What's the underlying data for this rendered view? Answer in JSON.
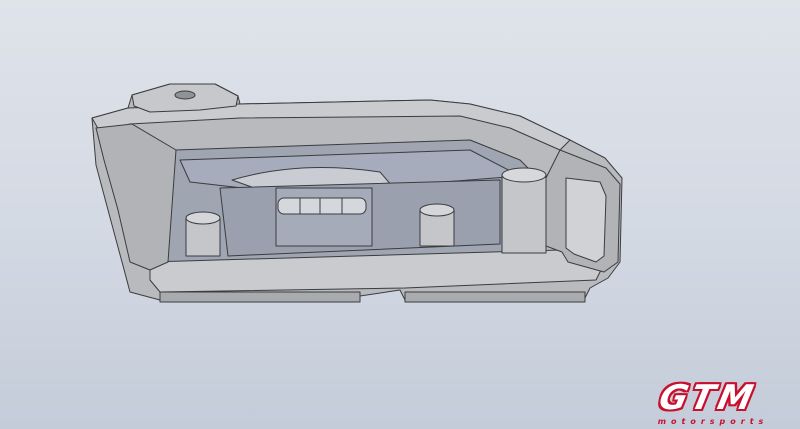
{
  "viewport": {
    "background_top": "#dfe3ea",
    "background_bottom": "#c4ccd9"
  },
  "model": {
    "part_color": "#b8babd",
    "part_shade": "#8f9296",
    "section_color": "#c9cbce",
    "inner_color": "#a9aeb8",
    "edge_color": "#3a3c3f"
  },
  "logo": {
    "brand": "GTM",
    "tagline": "motorsports",
    "accent_color": "#c8102e"
  }
}
